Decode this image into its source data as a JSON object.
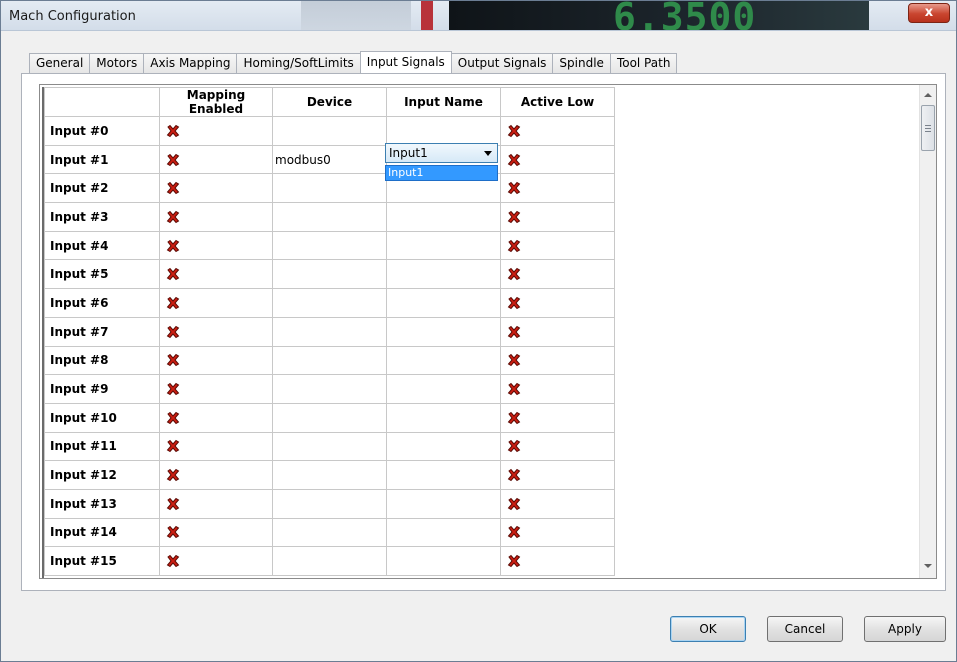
{
  "window": {
    "title": "Mach Configuration",
    "close_label": "x",
    "background_readout": "6.3500"
  },
  "tabs": [
    {
      "label": "General",
      "active": false
    },
    {
      "label": "Motors",
      "active": false
    },
    {
      "label": "Axis Mapping",
      "active": false
    },
    {
      "label": "Homing/SoftLimits",
      "active": false
    },
    {
      "label": "Input Signals",
      "active": true
    },
    {
      "label": "Output Signals",
      "active": false
    },
    {
      "label": "Spindle",
      "active": false
    },
    {
      "label": "Tool Path",
      "active": false
    }
  ],
  "grid": {
    "columns": [
      "",
      "Mapping Enabled",
      "Device",
      "Input Name",
      "Active Low"
    ],
    "rows": [
      {
        "label": "Input #0",
        "mapping_enabled": false,
        "device": "",
        "input_name": "",
        "active_low": false
      },
      {
        "label": "Input #1",
        "mapping_enabled": false,
        "device": "modbus0",
        "input_name": "Input1",
        "active_low": false
      },
      {
        "label": "Input #2",
        "mapping_enabled": false,
        "device": "",
        "input_name": "",
        "active_low": false
      },
      {
        "label": "Input #3",
        "mapping_enabled": false,
        "device": "",
        "input_name": "",
        "active_low": false
      },
      {
        "label": "Input #4",
        "mapping_enabled": false,
        "device": "",
        "input_name": "",
        "active_low": false
      },
      {
        "label": "Input #5",
        "mapping_enabled": false,
        "device": "",
        "input_name": "",
        "active_low": false
      },
      {
        "label": "Input #6",
        "mapping_enabled": false,
        "device": "",
        "input_name": "",
        "active_low": false
      },
      {
        "label": "Input #7",
        "mapping_enabled": false,
        "device": "",
        "input_name": "",
        "active_low": false
      },
      {
        "label": "Input #8",
        "mapping_enabled": false,
        "device": "",
        "input_name": "",
        "active_low": false
      },
      {
        "label": "Input #9",
        "mapping_enabled": false,
        "device": "",
        "input_name": "",
        "active_low": false
      },
      {
        "label": "Input #10",
        "mapping_enabled": false,
        "device": "",
        "input_name": "",
        "active_low": false
      },
      {
        "label": "Input #11",
        "mapping_enabled": false,
        "device": "",
        "input_name": "",
        "active_low": false
      },
      {
        "label": "Input #12",
        "mapping_enabled": false,
        "device": "",
        "input_name": "",
        "active_low": false
      },
      {
        "label": "Input #13",
        "mapping_enabled": false,
        "device": "",
        "input_name": "",
        "active_low": false
      },
      {
        "label": "Input #14",
        "mapping_enabled": false,
        "device": "",
        "input_name": "",
        "active_low": false
      },
      {
        "label": "Input #15",
        "mapping_enabled": false,
        "device": "",
        "input_name": "",
        "active_low": false
      }
    ],
    "disabled_icon": "red-x-icon"
  },
  "dropdown": {
    "selected": "Input1",
    "options": [
      "Input1"
    ]
  },
  "buttons": {
    "ok": "OK",
    "cancel": "Cancel",
    "apply": "Apply"
  },
  "colors": {
    "x_red": "#cc1e12",
    "selection_blue": "#3399ff"
  }
}
